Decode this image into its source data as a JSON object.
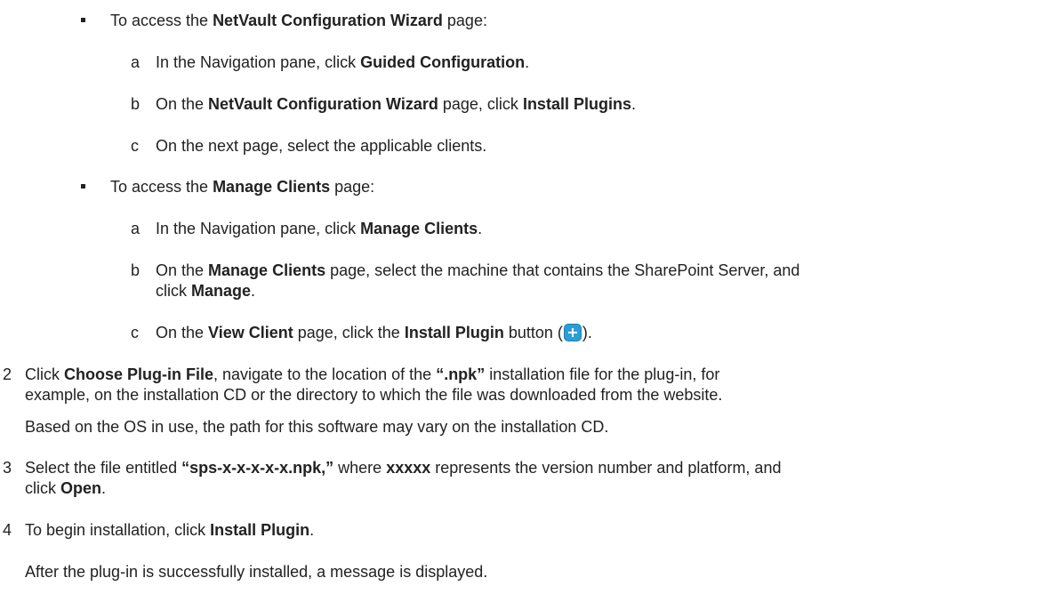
{
  "sub1": {
    "intro": [
      "To access the ",
      "NetVault Configuration Wizard",
      " page:"
    ],
    "a": {
      "letter": "a",
      "parts": [
        "In the Navigation pane, click ",
        "Guided Configuration",
        "."
      ]
    },
    "b": {
      "letter": "b",
      "parts": [
        "On the ",
        "NetVault Configuration Wizard",
        " page, click ",
        "Install Plugins",
        "."
      ]
    },
    "c": {
      "letter": "c",
      "text": "On the next page, select the applicable clients."
    }
  },
  "sub2": {
    "intro": [
      "To access the ",
      "Manage Clients",
      " page:"
    ],
    "a": {
      "letter": "a",
      "parts": [
        "In the Navigation pane, click ",
        "Manage Clients",
        "."
      ]
    },
    "b": {
      "letter": "b",
      "parts": [
        "On the ",
        "Manage Clients",
        " page, select the machine that contains the SharePoint Server, and",
        "click ",
        "Manage",
        "."
      ]
    },
    "c": {
      "letter": "c",
      "parts": [
        "On the ",
        "View Client",
        " page, click the ",
        "Install Plugin",
        " button (",
        ")."
      ],
      "icon": "plus-circle-icon"
    }
  },
  "step2": {
    "num": "2",
    "parts": [
      "Click ",
      "Choose Plug-in File",
      ", navigate to the location of the ",
      "“.npk”",
      " installation file for the plug-in, for"
    ],
    "line2": "example, on the installation CD or the directory to which the file was downloaded from the website.",
    "note": "Based on the OS in use, the path for this software may vary on the installation CD."
  },
  "step3": {
    "num": "3",
    "parts": [
      "Select the file entitled ",
      "“sps-x-x-x-x-x.npk,”",
      " where ",
      "xxxxx",
      " represents the version number and platform, and",
      "click ",
      "Open",
      "."
    ]
  },
  "step4": {
    "num": "4",
    "parts": [
      "To begin installation, click ",
      "Install Plugin",
      "."
    ],
    "note": "After the plug-in is successfully installed, a message is displayed."
  },
  "colors": {
    "text": "#222222",
    "icon": "#2a9fd6"
  }
}
